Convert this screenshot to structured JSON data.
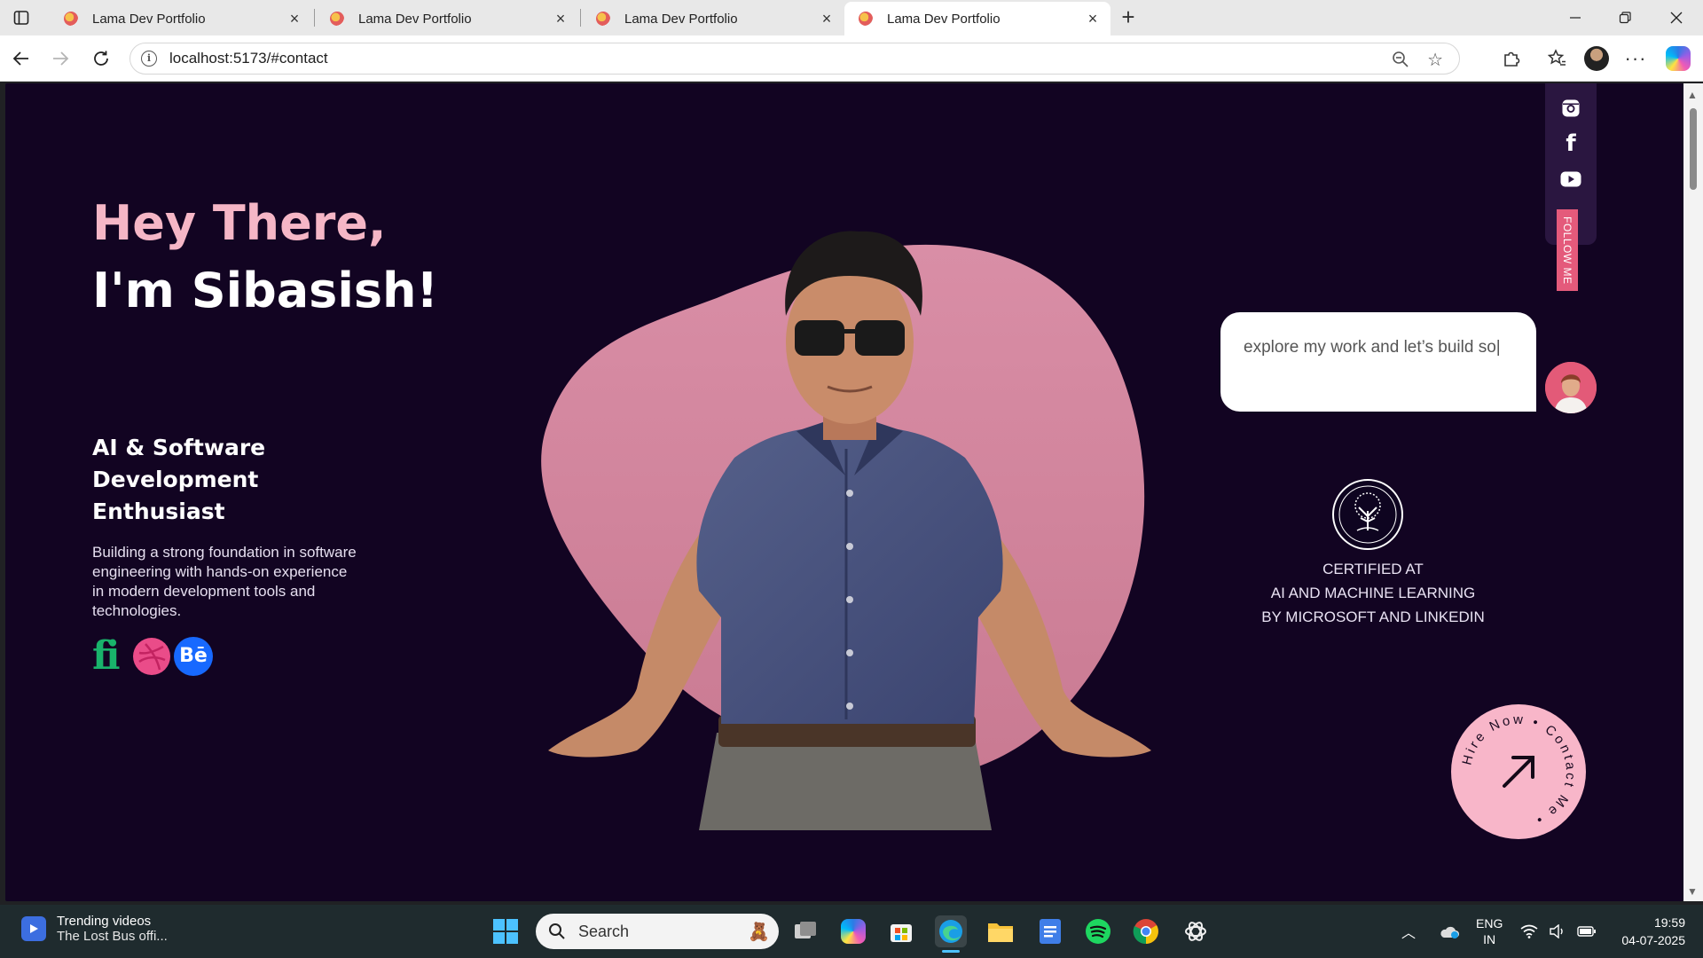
{
  "browser": {
    "tabs": [
      {
        "title": "Lama Dev Portfolio",
        "active": false
      },
      {
        "title": "Lama Dev Portfolio",
        "active": false
      },
      {
        "title": "Lama Dev Portfolio",
        "active": false
      },
      {
        "title": "Lama Dev Portfolio",
        "active": true
      }
    ],
    "url": "localhost:5173/#contact"
  },
  "hero": {
    "greeting": "Hey There,",
    "name": "I'm Sibasish!",
    "role": "AI & Software Development Enthusiast",
    "description": "Building a strong foundation in software engineering with hands-on experience in modern development tools and technologies.",
    "social_icons": [
      "fiverr-icon",
      "dribbble-icon",
      "behance-icon"
    ],
    "behance_glyph": "Bē",
    "fiverr_glyph": "fi"
  },
  "follow": {
    "label": "FOLLOW ME",
    "icons": [
      "instagram-icon",
      "facebook-icon",
      "youtube-icon"
    ]
  },
  "chat": {
    "text": "explore my work and let’s build so|"
  },
  "certificate": {
    "line1": "CERTIFIED AT",
    "line2": "AI AND MACHINE LEARNING",
    "line3": "BY MICROSOFT AND LINKEDIN"
  },
  "hire": {
    "ring_text": "Hire Now • Contact Me •",
    "arrow": "↗"
  },
  "taskbar": {
    "widget_title": "Trending videos",
    "widget_subtitle": "The Lost Bus offi...",
    "search_placeholder": "Search",
    "language_line1": "ENG",
    "language_line2": "IN",
    "time": "19:59",
    "date": "04-07-2025"
  },
  "colors": {
    "page_bg": "#120422",
    "accent_pink": "#f5b6c6",
    "blob": "#d4879f",
    "follow_label": "#e45a7b"
  }
}
